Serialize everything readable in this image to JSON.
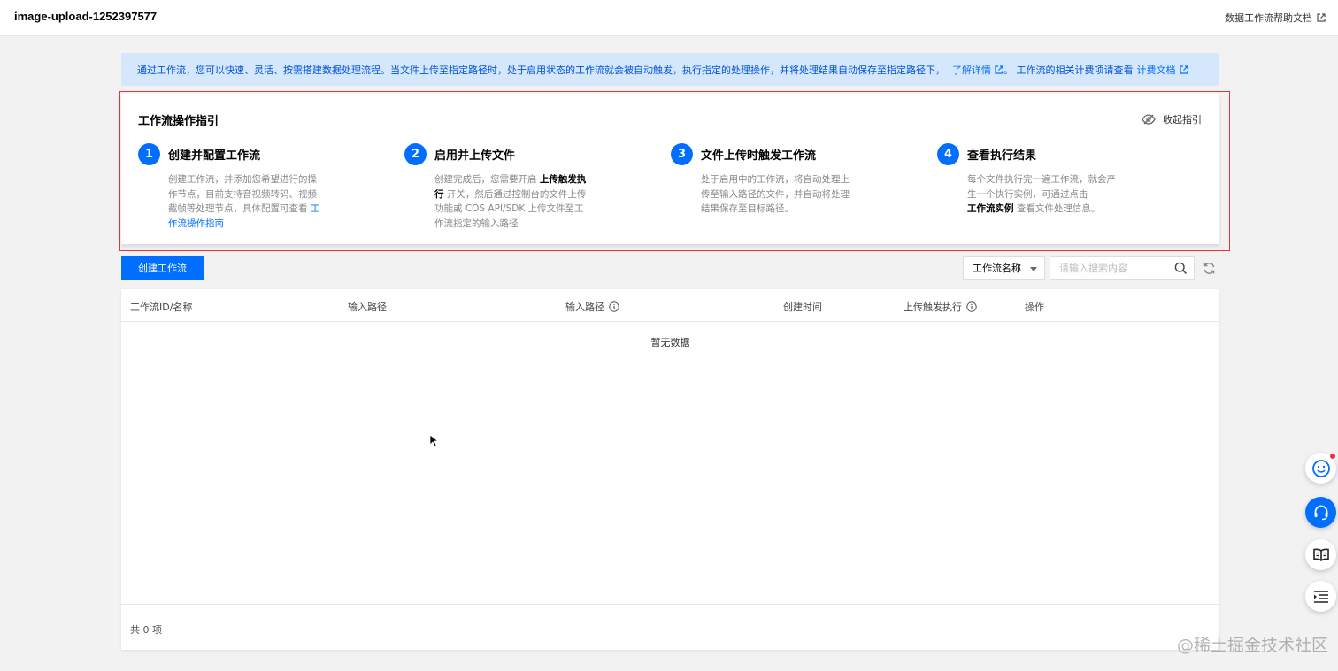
{
  "header": {
    "bucket_title": "image-upload-1252397577",
    "help_link": "数据工作流帮助文档"
  },
  "notice": {
    "text": "通过工作流，您可以快速、灵活、按需搭建数据处理流程。当文件上传至指定路径时，处于启用状态的工作流就会被自动触发，执行指定的处理操作，并将处理结果自动保存至指定路径下，",
    "learn_more": "了解详情",
    "billing_text": "。 工作流的相关计费项请查看",
    "billing_link": "计费文档"
  },
  "guide": {
    "title": "工作流操作指引",
    "collapse_label": "收起指引",
    "steps": [
      {
        "num": "1",
        "title": "创建并配置工作流",
        "desc_a": "创建工作流，并添加您希望进行的操作节点，目前支持音视频转码、视频截帧等处理节点，具体配置可查看",
        "desc_link": "工作流操作指南"
      },
      {
        "num": "2",
        "title": "启用并上传文件",
        "desc_a": "创建完成后，您需要开启",
        "desc_bold": "上传触发执行",
        "desc_b": "开关，然后通过控制台的文件上传功能或 COS API/SDK 上传文件至工作流指定的输入路径"
      },
      {
        "num": "3",
        "title": "文件上传时触发工作流",
        "desc_a": "处于启用中的工作流，将自动处理上传至输入路径的文件，并自动将处理结果保存至目标路径。"
      },
      {
        "num": "4",
        "title": "查看执行结果",
        "desc_a": "每个文件执行完一遍工作流，就会产生一个执行实例，可通过点击",
        "desc_bold": "工作流实例",
        "desc_b": "查看文件处理信息。"
      }
    ]
  },
  "toolbar": {
    "create_button": "创建工作流",
    "filter_select": "工作流名称",
    "search_placeholder": "请输入搜索内容"
  },
  "table": {
    "columns": [
      "工作流ID/名称",
      "输入路径",
      "输入路径",
      "创建时间",
      "上传触发执行",
      "操作"
    ],
    "empty_text": "暂无数据",
    "footer_total": "共 0 项"
  },
  "watermark": "@稀土掘金技术社区",
  "colors": {
    "primary": "#006eff",
    "notice_bg": "#d5e7fd",
    "highlight_border": "#e5343d"
  }
}
